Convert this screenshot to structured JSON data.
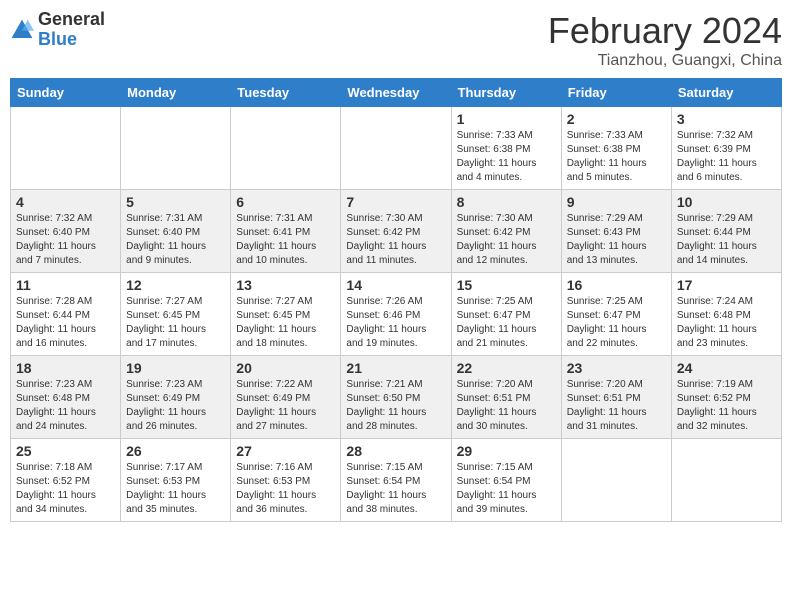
{
  "logo": {
    "general": "General",
    "blue": "Blue"
  },
  "title": "February 2024",
  "subtitle": "Tianzhou, Guangxi, China",
  "days_of_week": [
    "Sunday",
    "Monday",
    "Tuesday",
    "Wednesday",
    "Thursday",
    "Friday",
    "Saturday"
  ],
  "weeks": [
    [
      {
        "day": "",
        "info": ""
      },
      {
        "day": "",
        "info": ""
      },
      {
        "day": "",
        "info": ""
      },
      {
        "day": "",
        "info": ""
      },
      {
        "day": "1",
        "info": "Sunrise: 7:33 AM\nSunset: 6:38 PM\nDaylight: 11 hours and 4 minutes."
      },
      {
        "day": "2",
        "info": "Sunrise: 7:33 AM\nSunset: 6:38 PM\nDaylight: 11 hours and 5 minutes."
      },
      {
        "day": "3",
        "info": "Sunrise: 7:32 AM\nSunset: 6:39 PM\nDaylight: 11 hours and 6 minutes."
      }
    ],
    [
      {
        "day": "4",
        "info": "Sunrise: 7:32 AM\nSunset: 6:40 PM\nDaylight: 11 hours and 7 minutes."
      },
      {
        "day": "5",
        "info": "Sunrise: 7:31 AM\nSunset: 6:40 PM\nDaylight: 11 hours and 9 minutes."
      },
      {
        "day": "6",
        "info": "Sunrise: 7:31 AM\nSunset: 6:41 PM\nDaylight: 11 hours and 10 minutes."
      },
      {
        "day": "7",
        "info": "Sunrise: 7:30 AM\nSunset: 6:42 PM\nDaylight: 11 hours and 11 minutes."
      },
      {
        "day": "8",
        "info": "Sunrise: 7:30 AM\nSunset: 6:42 PM\nDaylight: 11 hours and 12 minutes."
      },
      {
        "day": "9",
        "info": "Sunrise: 7:29 AM\nSunset: 6:43 PM\nDaylight: 11 hours and 13 minutes."
      },
      {
        "day": "10",
        "info": "Sunrise: 7:29 AM\nSunset: 6:44 PM\nDaylight: 11 hours and 14 minutes."
      }
    ],
    [
      {
        "day": "11",
        "info": "Sunrise: 7:28 AM\nSunset: 6:44 PM\nDaylight: 11 hours and 16 minutes."
      },
      {
        "day": "12",
        "info": "Sunrise: 7:27 AM\nSunset: 6:45 PM\nDaylight: 11 hours and 17 minutes."
      },
      {
        "day": "13",
        "info": "Sunrise: 7:27 AM\nSunset: 6:45 PM\nDaylight: 11 hours and 18 minutes."
      },
      {
        "day": "14",
        "info": "Sunrise: 7:26 AM\nSunset: 6:46 PM\nDaylight: 11 hours and 19 minutes."
      },
      {
        "day": "15",
        "info": "Sunrise: 7:25 AM\nSunset: 6:47 PM\nDaylight: 11 hours and 21 minutes."
      },
      {
        "day": "16",
        "info": "Sunrise: 7:25 AM\nSunset: 6:47 PM\nDaylight: 11 hours and 22 minutes."
      },
      {
        "day": "17",
        "info": "Sunrise: 7:24 AM\nSunset: 6:48 PM\nDaylight: 11 hours and 23 minutes."
      }
    ],
    [
      {
        "day": "18",
        "info": "Sunrise: 7:23 AM\nSunset: 6:48 PM\nDaylight: 11 hours and 24 minutes."
      },
      {
        "day": "19",
        "info": "Sunrise: 7:23 AM\nSunset: 6:49 PM\nDaylight: 11 hours and 26 minutes."
      },
      {
        "day": "20",
        "info": "Sunrise: 7:22 AM\nSunset: 6:49 PM\nDaylight: 11 hours and 27 minutes."
      },
      {
        "day": "21",
        "info": "Sunrise: 7:21 AM\nSunset: 6:50 PM\nDaylight: 11 hours and 28 minutes."
      },
      {
        "day": "22",
        "info": "Sunrise: 7:20 AM\nSunset: 6:51 PM\nDaylight: 11 hours and 30 minutes."
      },
      {
        "day": "23",
        "info": "Sunrise: 7:20 AM\nSunset: 6:51 PM\nDaylight: 11 hours and 31 minutes."
      },
      {
        "day": "24",
        "info": "Sunrise: 7:19 AM\nSunset: 6:52 PM\nDaylight: 11 hours and 32 minutes."
      }
    ],
    [
      {
        "day": "25",
        "info": "Sunrise: 7:18 AM\nSunset: 6:52 PM\nDaylight: 11 hours and 34 minutes."
      },
      {
        "day": "26",
        "info": "Sunrise: 7:17 AM\nSunset: 6:53 PM\nDaylight: 11 hours and 35 minutes."
      },
      {
        "day": "27",
        "info": "Sunrise: 7:16 AM\nSunset: 6:53 PM\nDaylight: 11 hours and 36 minutes."
      },
      {
        "day": "28",
        "info": "Sunrise: 7:15 AM\nSunset: 6:54 PM\nDaylight: 11 hours and 38 minutes."
      },
      {
        "day": "29",
        "info": "Sunrise: 7:15 AM\nSunset: 6:54 PM\nDaylight: 11 hours and 39 minutes."
      },
      {
        "day": "",
        "info": ""
      },
      {
        "day": "",
        "info": ""
      }
    ]
  ]
}
